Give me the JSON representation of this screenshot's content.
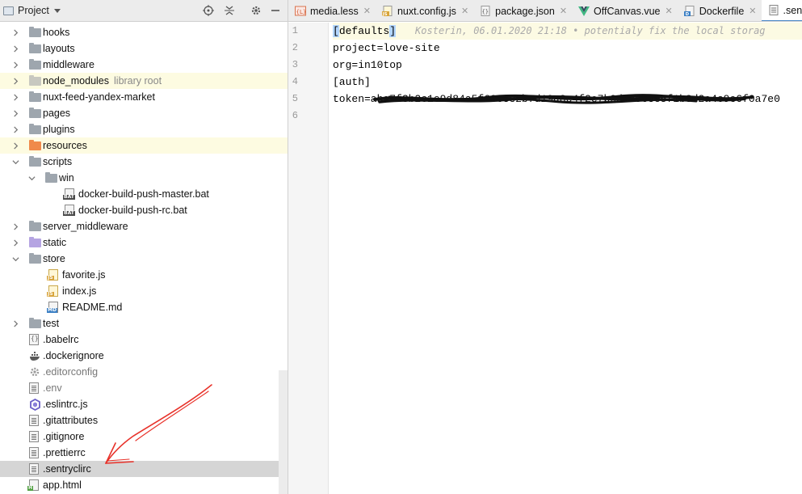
{
  "project_panel": {
    "title": "Project",
    "tree": [
      {
        "label": "hooks",
        "kind": "folder",
        "chevron": "right",
        "indent": 0
      },
      {
        "label": "layouts",
        "kind": "folder",
        "chevron": "right",
        "indent": 0
      },
      {
        "label": "middleware",
        "kind": "folder",
        "chevron": "right",
        "indent": 0
      },
      {
        "label": "node_modules",
        "kind": "folder-lib",
        "chevron": "right",
        "indent": 0,
        "hint": "library root",
        "highlight": true
      },
      {
        "label": "nuxt-feed-yandex-market",
        "kind": "folder",
        "chevron": "right",
        "indent": 0
      },
      {
        "label": "pages",
        "kind": "folder",
        "chevron": "right",
        "indent": 0
      },
      {
        "label": "plugins",
        "kind": "folder",
        "chevron": "right",
        "indent": 0
      },
      {
        "label": "resources",
        "kind": "folder-res",
        "chevron": "right",
        "indent": 0,
        "highlight": true
      },
      {
        "label": "scripts",
        "kind": "folder",
        "chevron": "down",
        "indent": 0
      },
      {
        "label": "win",
        "kind": "folder",
        "chevron": "down",
        "indent": 1
      },
      {
        "label": "docker-build-push-master.bat",
        "kind": "bat",
        "indent": 2
      },
      {
        "label": "docker-build-push-rc.bat",
        "kind": "bat",
        "indent": 2
      },
      {
        "label": "server_middleware",
        "kind": "folder",
        "chevron": "right",
        "indent": 0
      },
      {
        "label": "static",
        "kind": "folder-static",
        "chevron": "right",
        "indent": 0
      },
      {
        "label": "store",
        "kind": "folder",
        "chevron": "down",
        "indent": 0
      },
      {
        "label": "favorite.js",
        "kind": "js",
        "indent": 1
      },
      {
        "label": "index.js",
        "kind": "js",
        "indent": 1
      },
      {
        "label": "README.md",
        "kind": "md",
        "indent": 1
      },
      {
        "label": "test",
        "kind": "folder",
        "chevron": "right",
        "indent": 0
      },
      {
        "label": ".babelrc",
        "kind": "config-braces",
        "indent": 0
      },
      {
        "label": ".dockerignore",
        "kind": "docker",
        "indent": 0
      },
      {
        "label": ".editorconfig",
        "kind": "gear",
        "indent": 0,
        "dim": true
      },
      {
        "label": ".env",
        "kind": "text",
        "indent": 0,
        "dim": true
      },
      {
        "label": ".eslintrc.js",
        "kind": "eslint",
        "indent": 0
      },
      {
        "label": ".gitattributes",
        "kind": "text",
        "indent": 0
      },
      {
        "label": ".gitignore",
        "kind": "text",
        "indent": 0
      },
      {
        "label": ".prettierrc",
        "kind": "text",
        "indent": 0
      },
      {
        "label": ".sentryclirc",
        "kind": "text",
        "indent": 0,
        "selected": true
      },
      {
        "label": "app.html",
        "kind": "html",
        "indent": 0
      }
    ]
  },
  "editor": {
    "tabs": [
      {
        "label": "media.less",
        "icon": "less",
        "closable": true
      },
      {
        "label": "nuxt.config.js",
        "icon": "js",
        "closable": true
      },
      {
        "label": "package.json",
        "icon": "json",
        "closable": true
      },
      {
        "label": "OffCanvas.vue",
        "icon": "vue",
        "closable": true
      },
      {
        "label": "Dockerfile",
        "icon": "docker",
        "closable": true
      },
      {
        "label": ".sentrycl",
        "icon": "text",
        "active": true
      }
    ],
    "line_numbers": [
      "1",
      "2",
      "3",
      "4",
      "5",
      "6"
    ],
    "lines": [
      {
        "bracket_open": "[",
        "text": "defaults",
        "bracket_close": "]",
        "blame": "Kosterin, 06.01.2020 21:18 • potentialy fix the local storag"
      },
      {
        "text": "project=love-site"
      },
      {
        "text": "org=in10top"
      },
      {
        "text": "[auth]"
      },
      {
        "text": "token=aba7f3b2c1e9d84a5f60c3e2b7d19a8c4f2e7b0d6a9c3e5f1b8d2a4c9e6f0a7e0"
      },
      {
        "text": ""
      }
    ]
  },
  "colors": {
    "selection": "#d5d5d5",
    "highlight_row": "#fdfbe1",
    "active_tab_underline": "#4a88c7",
    "annotation_red": "#e8322a"
  }
}
